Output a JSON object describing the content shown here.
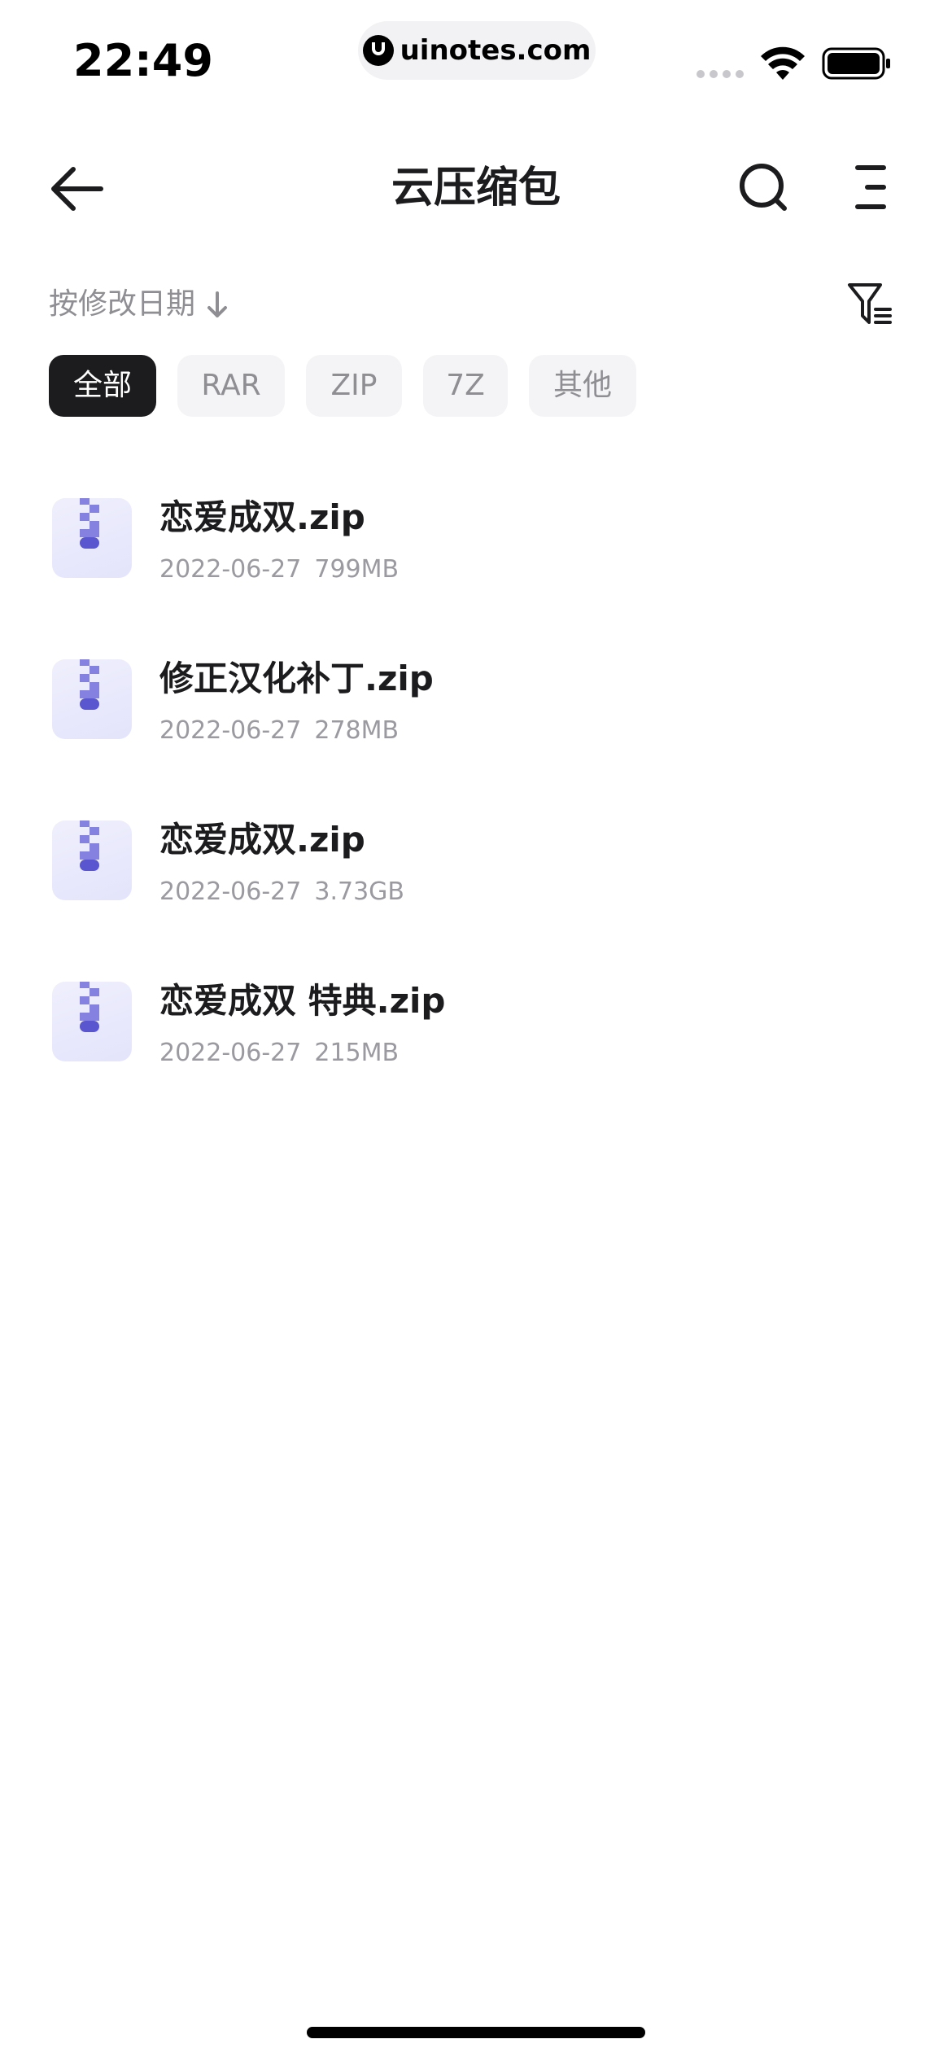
{
  "status_bar": {
    "time": "22:49",
    "url": "uinotes.com"
  },
  "header": {
    "title": "云压缩包"
  },
  "sort": {
    "label": "按修改日期"
  },
  "filters": [
    {
      "label": "全部",
      "active": true
    },
    {
      "label": "RAR",
      "active": false
    },
    {
      "label": "ZIP",
      "active": false
    },
    {
      "label": "7Z",
      "active": false
    },
    {
      "label": "其他",
      "active": false
    }
  ],
  "files": [
    {
      "name": "恋爱成双.zip",
      "date": "2022-06-27",
      "size": "799MB"
    },
    {
      "name": "修正汉化补丁.zip",
      "date": "2022-06-27",
      "size": "278MB"
    },
    {
      "name": "恋爱成双.zip",
      "date": "2022-06-27",
      "size": "3.73GB"
    },
    {
      "name": "恋爱成双 特典.zip",
      "date": "2022-06-27",
      "size": "215MB"
    }
  ],
  "colors": {
    "accent_dark": "#1c1c1e",
    "muted_text": "#8e8e93",
    "zip_icon_bg": "#e9e9fc",
    "zip_icon_fg": "#6a67d8"
  },
  "icons": {
    "back": "arrow-left-icon",
    "search": "search-icon",
    "menu": "menu-icon",
    "sort": "arrow-down-icon",
    "filter": "filter-icon",
    "file": "zip-file-icon"
  }
}
